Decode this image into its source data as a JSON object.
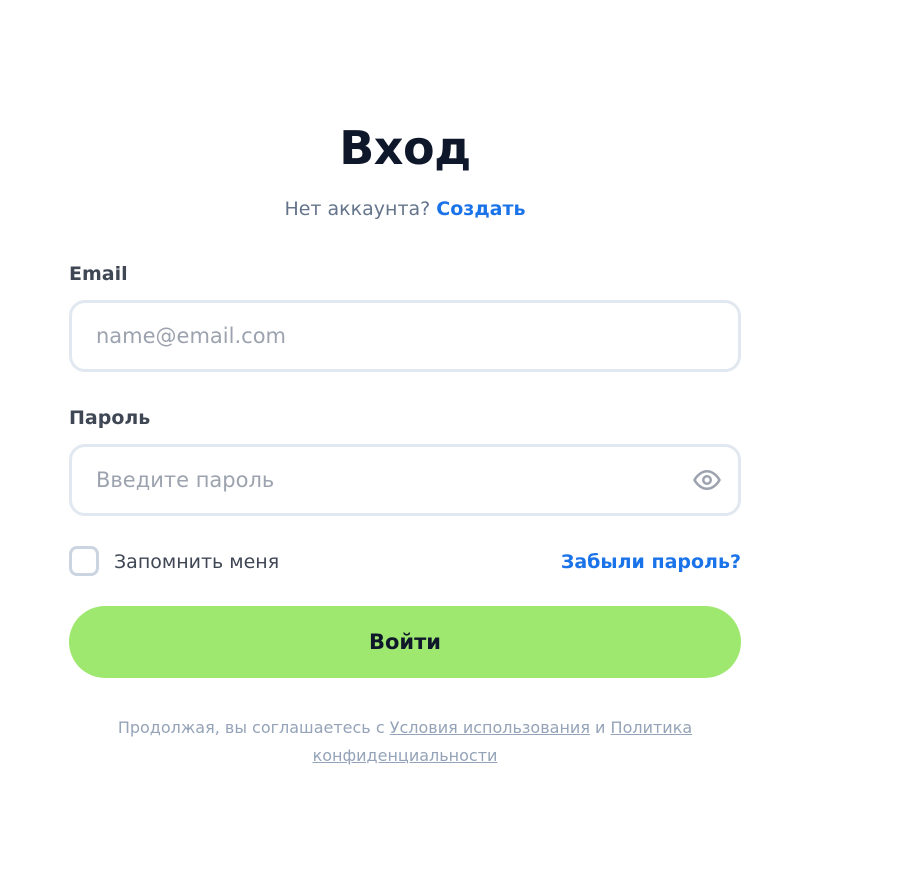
{
  "header": {
    "title": "Вход",
    "no_account_text": "Нет аккаунта?",
    "create_link": "Создать"
  },
  "email": {
    "label": "Email",
    "placeholder": "name@email.com",
    "value": ""
  },
  "password": {
    "label": "Пароль",
    "placeholder": "Введите пароль",
    "value": "",
    "toggle_icon": "eye-icon"
  },
  "remember": {
    "label": "Запомнить меня",
    "checked": false
  },
  "forgot_link": "Забыли пароль?",
  "submit_label": "Войти",
  "terms": {
    "prefix": "Продолжая, вы соглашаетесь с",
    "terms_link": "Условия использования",
    "conjunction": "и",
    "privacy_link": "Политика конфиденциальности"
  },
  "colors": {
    "accent": "#1a73e8",
    "primary_button": "#9fe870",
    "title": "#0f172a",
    "border": "#e2e8f0"
  }
}
